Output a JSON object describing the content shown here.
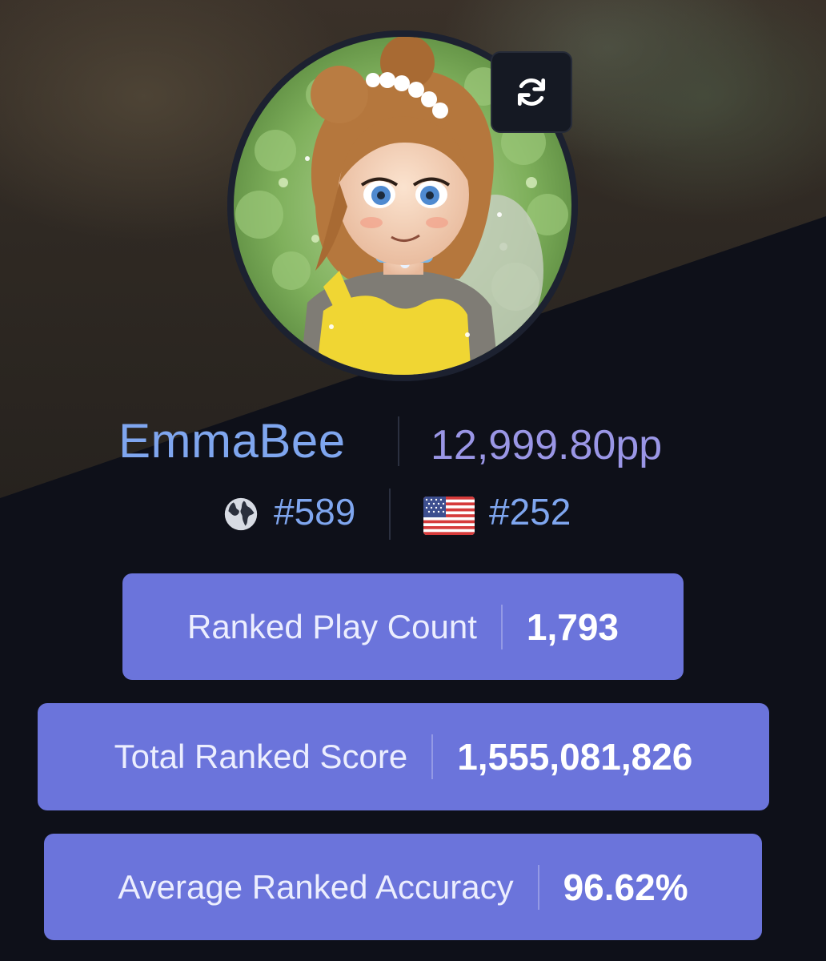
{
  "profile": {
    "username": "EmmaBee",
    "pp": "12,999.80pp",
    "global_rank": "#589",
    "country_rank": "#252",
    "country_flag": "united-states-flag",
    "refresh_icon": "refresh-icon",
    "globe_icon": "globe-icon"
  },
  "stats": [
    {
      "label": "Ranked Play Count",
      "value": "1,793"
    },
    {
      "label": "Total Ranked Score",
      "value": "1,555,081,826"
    },
    {
      "label": "Average Ranked Accuracy",
      "value": "96.62%"
    }
  ],
  "colors": {
    "background": "#0e1019",
    "accent_blue": "#7fa6ef",
    "pp_purple": "#9a96e6",
    "stat_card": "#6b74db"
  }
}
